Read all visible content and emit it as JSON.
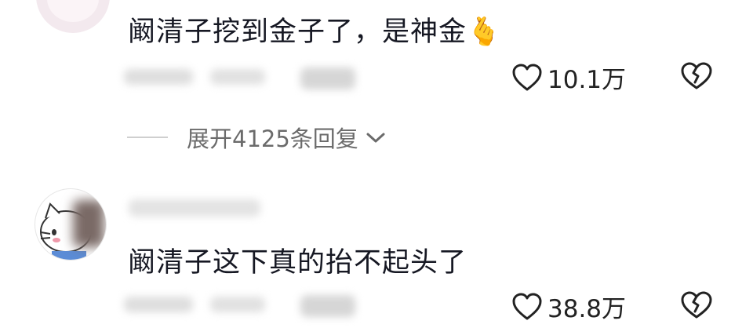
{
  "comments": [
    {
      "text": "阚清子挖到金子了，是神金",
      "emoji": "🫰",
      "likes": "10.1万",
      "replies": "展开4125条回复"
    },
    {
      "text": "阚清子这下真的抬不起头了",
      "likes": "38.8万"
    }
  ],
  "icons": {
    "like": "heart-outline-icon",
    "dislike": "broken-heart-icon",
    "expand": "chevron-down-icon"
  },
  "colors": {
    "text": "#161823",
    "meta": "#222222",
    "secondary": "#6b6b6b",
    "blur": "#d9d9d9"
  }
}
